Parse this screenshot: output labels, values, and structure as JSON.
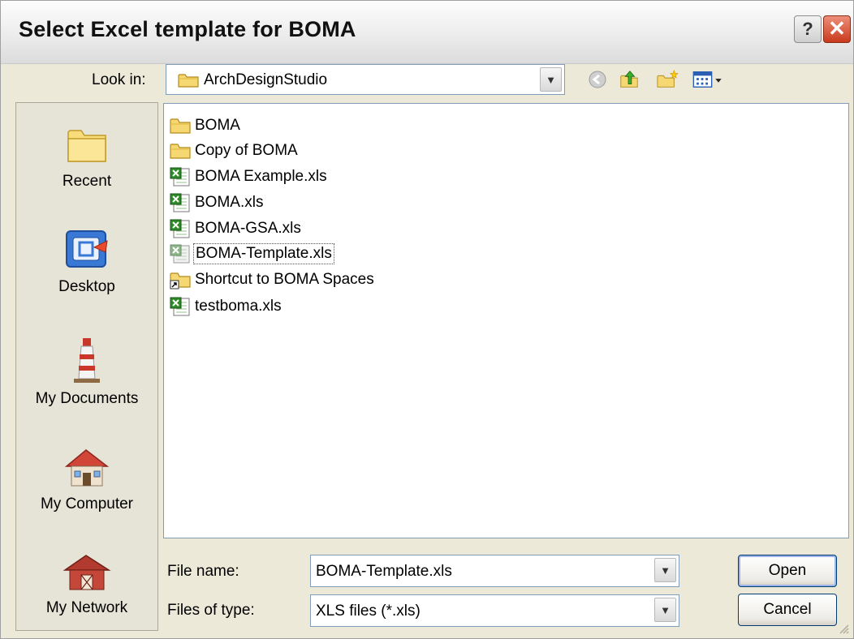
{
  "dialog": {
    "title": "Select Excel template for BOMA",
    "help_label": "?",
    "close_label": "✕"
  },
  "look_in": {
    "label": "Look in:",
    "value": "ArchDesignStudio"
  },
  "toolbar": {
    "icons": [
      "back-icon",
      "up-folder-icon",
      "new-folder-icon",
      "views-menu-icon"
    ]
  },
  "places": [
    {
      "label": "Recent",
      "icon": "recent-folder-icon"
    },
    {
      "label": "Desktop",
      "icon": "desktop-icon"
    },
    {
      "label": "My Documents",
      "icon": "lighthouse-icon"
    },
    {
      "label": "My Computer",
      "icon": "house-icon"
    },
    {
      "label": "My Network",
      "icon": "network-barn-icon"
    }
  ],
  "files": [
    {
      "name": "BOMA",
      "type": "folder"
    },
    {
      "name": "Copy of BOMA",
      "type": "folder"
    },
    {
      "name": "BOMA Example.xls",
      "type": "excel"
    },
    {
      "name": "BOMA.xls",
      "type": "excel"
    },
    {
      "name": "BOMA-GSA.xls",
      "type": "excel"
    },
    {
      "name": "BOMA-Template.xls",
      "type": "excel-selected",
      "selected": true
    },
    {
      "name": "Shortcut to BOMA Spaces",
      "type": "shortcut"
    },
    {
      "name": "testboma.xls",
      "type": "excel"
    }
  ],
  "file_name": {
    "label": "File name:",
    "value": "BOMA-Template.xls"
  },
  "file_type": {
    "label": "Files of type:",
    "value": "XLS files (*.xls)"
  },
  "buttons": {
    "open": "Open",
    "cancel": "Cancel"
  },
  "colors": {
    "selection_border": "#555555",
    "input_border": "#7f9db9",
    "close_button": "#c83a1c",
    "dialog_bg": "#ece9d8"
  }
}
